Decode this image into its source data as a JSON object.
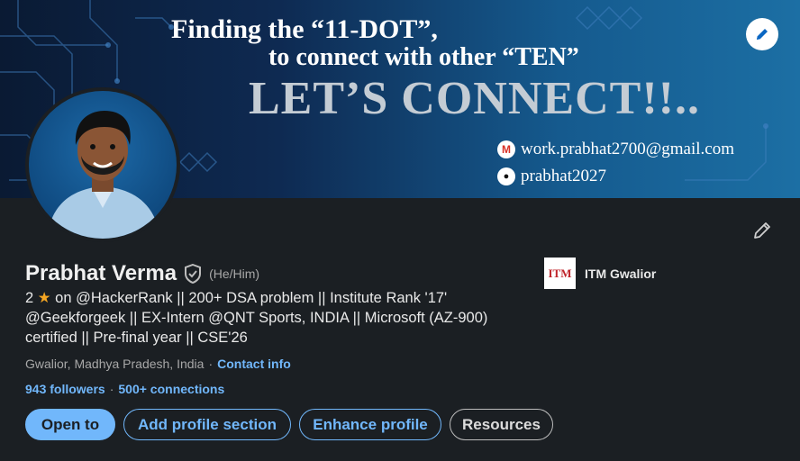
{
  "banner": {
    "line1": "Finding the “11-DOT”,",
    "line2": "to connect with other “TEN”",
    "line3": "LET’S CONNECT!!..",
    "email": "work.prabhat2700@gmail.com",
    "github": "prabhat2027",
    "email_icon_glyph": "M",
    "github_icon_glyph": "●"
  },
  "profile": {
    "name": "Prabhat Verma",
    "pronouns": "(He/Him)",
    "headline_prefix": "2",
    "headline_star": "★",
    "headline_rest": " on @HackerRank || 200+ DSA problem || Institute Rank '17' @Geekforgeek || EX-Intern @QNT Sports, INDIA || Microsoft (AZ-900) certified || Pre-final year || CSE'26",
    "location": "Gwalior, Madhya Pradesh, India",
    "location_separator": "·",
    "contact_info_label": "Contact info",
    "followers": "943 followers",
    "stats_separator": "·",
    "connections": "500+ connections"
  },
  "company": {
    "logo_text": "ITM",
    "name": "ITM Gwalior"
  },
  "actions": {
    "open_to": "Open to",
    "add_profile_section": "Add profile section",
    "enhance_profile": "Enhance profile",
    "resources": "Resources"
  },
  "icons": {
    "edit_banner": "pencil-icon",
    "edit_intro": "pencil-icon",
    "verified": "shield-check-icon"
  },
  "colors": {
    "background": "#1b1f23",
    "link": "#71b7fb",
    "primary_button": "#71b7fb",
    "star": "#f5a623",
    "muted_text": "#a8a8a8"
  }
}
